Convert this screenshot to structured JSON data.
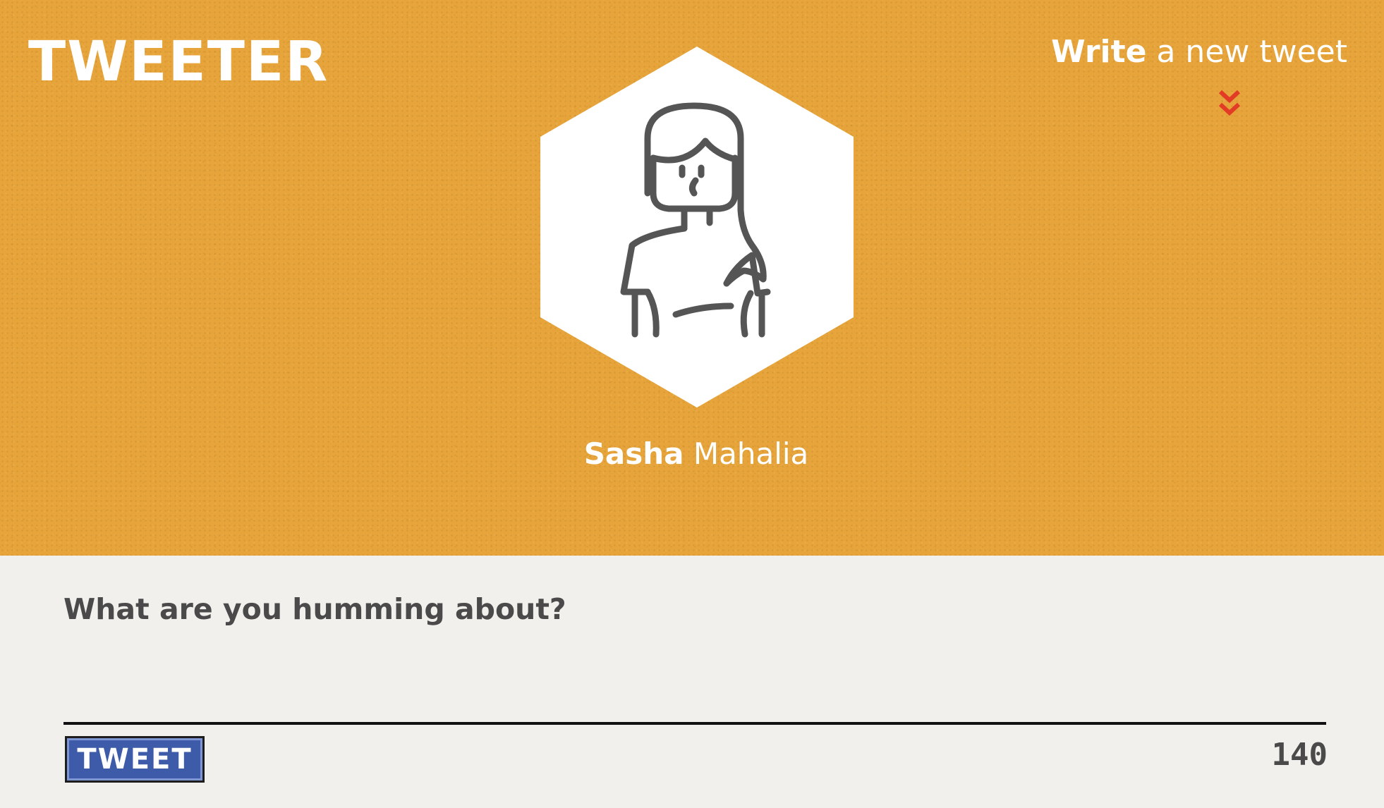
{
  "app": {
    "logo": "TWEETER",
    "accent": "#e6a43b",
    "button_color": "#3e5ba9",
    "chevron_color": "#e23b26"
  },
  "header": {
    "new_tweet_strong": "Write",
    "new_tweet_rest": " a new tweet",
    "chevron_icon": "double-chevron-down-icon"
  },
  "profile": {
    "first_name": "Sasha",
    "last_name": " Mahalia",
    "avatar_icon": "woman-avatar-icon"
  },
  "compose": {
    "placeholder": "What are you humming about?",
    "value": "",
    "button_label": "TWEET",
    "char_count": "140"
  }
}
